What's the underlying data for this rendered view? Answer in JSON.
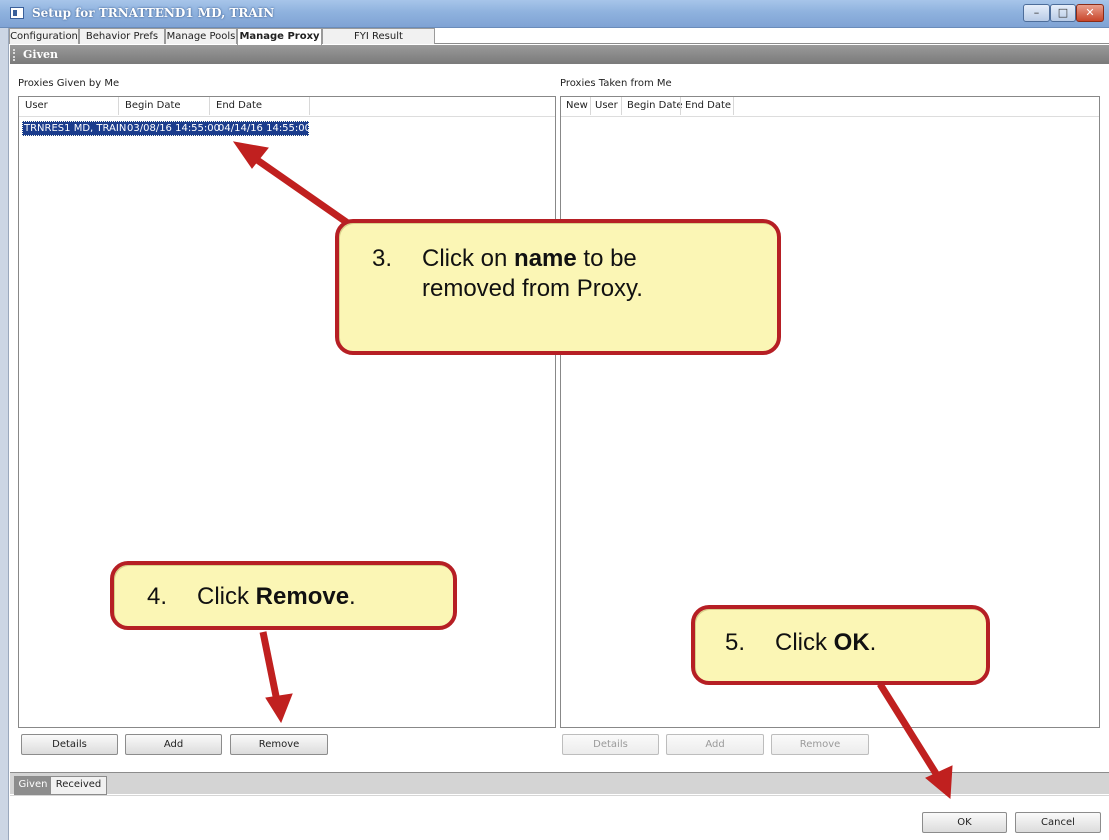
{
  "window": {
    "title": "Setup for TRNATTEND1 MD, TRAIN",
    "controls": {
      "minimize": "–",
      "maximize": "□",
      "close": "✕"
    }
  },
  "tabs": [
    {
      "label": "Configuration",
      "active": false
    },
    {
      "label": "Behavior Prefs",
      "active": false
    },
    {
      "label": "Manage Pools",
      "active": false
    },
    {
      "label": "Manage Proxy",
      "active": true
    },
    {
      "label": "FYI Result Subscriptions",
      "active": false
    }
  ],
  "section_header": "Given",
  "left_panel": {
    "title": "Proxies Given by Me",
    "columns": [
      "User",
      "Begin Date",
      "End Date"
    ],
    "rows": [
      {
        "user": "TRNRES1 MD, TRAIN",
        "begin_date": "03/08/16 14:55:00",
        "end_date": "04/14/16 14:55:00",
        "selected": true
      }
    ],
    "buttons": {
      "details": "Details",
      "add": "Add",
      "remove": "Remove"
    }
  },
  "right_panel": {
    "title": "Proxies Taken from Me",
    "columns": [
      "New",
      "User",
      "Begin Date",
      "End Date"
    ],
    "rows": [],
    "buttons": {
      "details": "Details",
      "add": "Add",
      "remove": "Remove"
    }
  },
  "bottom_tabs": [
    {
      "label": "Given",
      "active": true
    },
    {
      "label": "Received",
      "active": false
    }
  ],
  "dialog_buttons": {
    "ok": "OK",
    "cancel": "Cancel"
  },
  "callouts": {
    "step3": {
      "number": "3.",
      "pre": "Click on ",
      "bold": "name",
      "post": " to be",
      "line2": "removed from Proxy."
    },
    "step4": {
      "number": "4.",
      "pre": "Click ",
      "bold": "Remove",
      "post": "."
    },
    "step5": {
      "number": "5.",
      "pre": "Click ",
      "bold": "OK",
      "post": "."
    }
  },
  "colors": {
    "callout_border": "#b61f24",
    "callout_fill": "#fbf6b5",
    "arrow": "#c0201f",
    "selection": "#1b3c8c"
  }
}
